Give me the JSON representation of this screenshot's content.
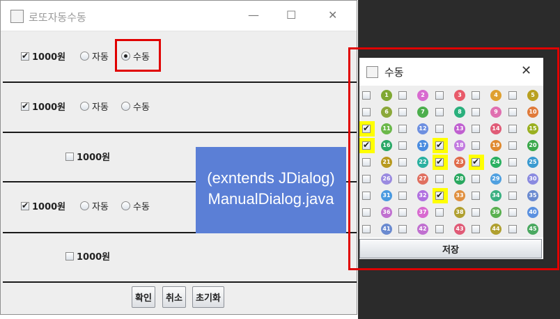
{
  "main_window": {
    "title": "로또자동수동",
    "minimize": "—",
    "maximize": "☐",
    "close": "✕"
  },
  "rows": [
    {
      "price": "1000원",
      "checked": true,
      "auto": "자동",
      "manual": "수동",
      "mode": "manual",
      "show_modes": true
    },
    {
      "price": "1000원",
      "checked": true,
      "auto": "자동",
      "manual": "수동",
      "mode": "none",
      "show_modes": true
    },
    {
      "price": "1000원",
      "checked": false,
      "show_modes": false
    },
    {
      "price": "1000원",
      "checked": true,
      "auto": "자동",
      "manual": "수동",
      "mode": "none",
      "show_modes": true
    },
    {
      "price": "1000원",
      "checked": false,
      "show_modes": false
    }
  ],
  "buttons": {
    "confirm": "확인",
    "cancel": "취소",
    "reset": "초기화"
  },
  "annotation": {
    "line1": "(exntends  JDialog)",
    "line2": "ManualDialog.java"
  },
  "dialog": {
    "title": "수동",
    "close": "✕",
    "save": "저장",
    "checked_numbers": [
      11,
      16,
      18,
      23,
      24,
      33
    ],
    "numbers": [
      1,
      2,
      3,
      4,
      5,
      6,
      7,
      8,
      9,
      10,
      11,
      12,
      13,
      14,
      15,
      16,
      17,
      18,
      19,
      20,
      21,
      22,
      23,
      24,
      25,
      26,
      27,
      28,
      29,
      30,
      31,
      32,
      33,
      34,
      35,
      36,
      37,
      38,
      39,
      40,
      41,
      42,
      43,
      44,
      45
    ]
  },
  "colors": {
    "highlight_red": "#e00000",
    "note_blue": "#5b7fd6",
    "check_highlight": "#ffff00",
    "ball_palette": [
      "#7fa832",
      "#d86ad0",
      "#e85b6a",
      "#dfa030",
      "#b9a020",
      "#8ba83a",
      "#4cae4c",
      "#2bb07d",
      "#e06fb0",
      "#e07a3a",
      "#6bb84a",
      "#6d8fe0",
      "#c060d0",
      "#e05b77",
      "#9ab020",
      "#2aa866",
      "#4a8ce0",
      "#c27ae0",
      "#e08a30",
      "#3aa84a",
      "#b89a20",
      "#2ab0a0",
      "#e06b4a",
      "#2ab060",
      "#3a9ad0",
      "#9a8ae0",
      "#e07060",
      "#2aa860",
      "#50a0e0",
      "#8a8ae0",
      "#4a9ae0",
      "#b070e0",
      "#e09040",
      "#3ab080",
      "#6a8ad0",
      "#c070d0",
      "#d86ad0",
      "#b0a030",
      "#5ab050",
      "#5a90e0",
      "#6a8ad0",
      "#c070d0",
      "#e05b77",
      "#b0a030",
      "#4aa860"
    ]
  }
}
